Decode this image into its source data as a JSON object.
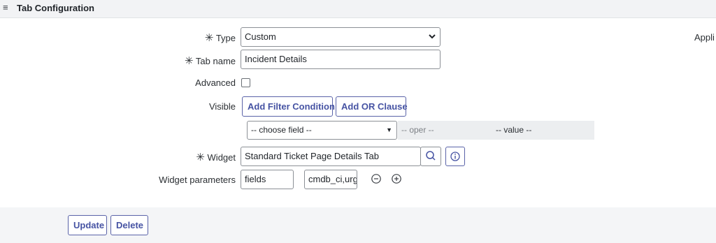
{
  "header": {
    "title": "Tab Configuration",
    "menu_icon": "hamburger-icon"
  },
  "form": {
    "type": {
      "label": "Type",
      "value": "Custom"
    },
    "tab_name": {
      "label": "Tab name",
      "value": "Incident Details"
    },
    "advanced": {
      "label": "Advanced",
      "checked": false
    },
    "visible": {
      "label": "Visible",
      "add_filter_label": "Add Filter Condition",
      "add_or_label": "Add OR Clause",
      "field_placeholder": "-- choose field --",
      "oper_placeholder": "-- oper --",
      "value_placeholder": "-- value --"
    },
    "widget": {
      "label": "Widget",
      "value": "Standard Ticket Page Details Tab"
    },
    "widget_parameters": {
      "label": "Widget parameters",
      "key": "fields",
      "value": "cmdb_ci,urge"
    },
    "required_mark": "✳"
  },
  "side": {
    "clipped_text": "Appli"
  },
  "footer": {
    "update_label": "Update",
    "delete_label": "Delete"
  },
  "colors": {
    "accent": "#4653a3",
    "header_bg": "#f2f3f5",
    "footer_bg": "#f4f5f7"
  }
}
